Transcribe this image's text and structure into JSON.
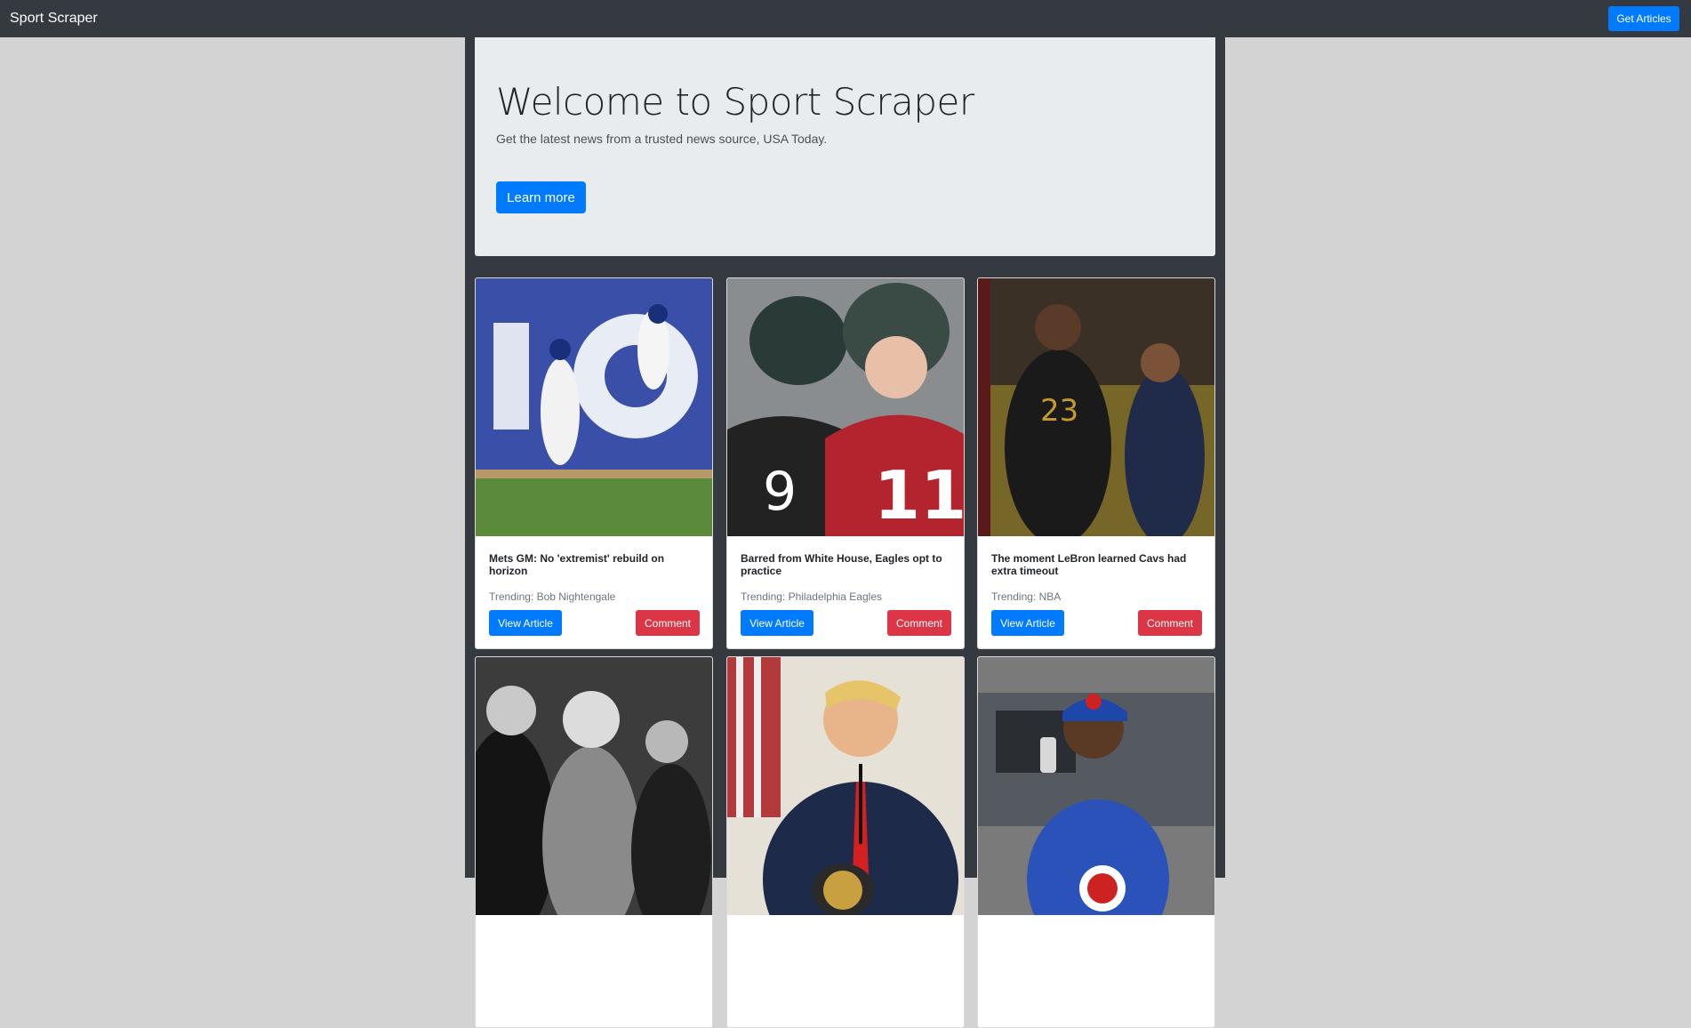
{
  "navbar": {
    "brand": "Sport Scraper",
    "get_articles_label": "Get Articles"
  },
  "jumbotron": {
    "title": "Welcome to Sport Scraper",
    "lead": "Get the latest news from a trusted news source, USA Today.",
    "learn_more_label": "Learn more"
  },
  "articles": [
    {
      "title": "Mets GM: No 'extremist' rebuild on horizon",
      "trending": "Trending: Bob Nightengale",
      "view_label": "View Article",
      "comment_label": "Comment"
    },
    {
      "title": "Barred from White House, Eagles opt to practice",
      "trending": "Trending: Philadelphia Eagles",
      "view_label": "View Article",
      "comment_label": "Comment"
    },
    {
      "title": "The moment LeBron learned Cavs had extra timeout",
      "trending": "Trending: NBA",
      "view_label": "View Article",
      "comment_label": "Comment"
    }
  ],
  "colors": {
    "navbar_bg": "#343a40",
    "page_bg": "#d3d3d3",
    "jumbotron_bg": "#e9ecef",
    "primary": "#007bff",
    "danger": "#dc3545"
  }
}
